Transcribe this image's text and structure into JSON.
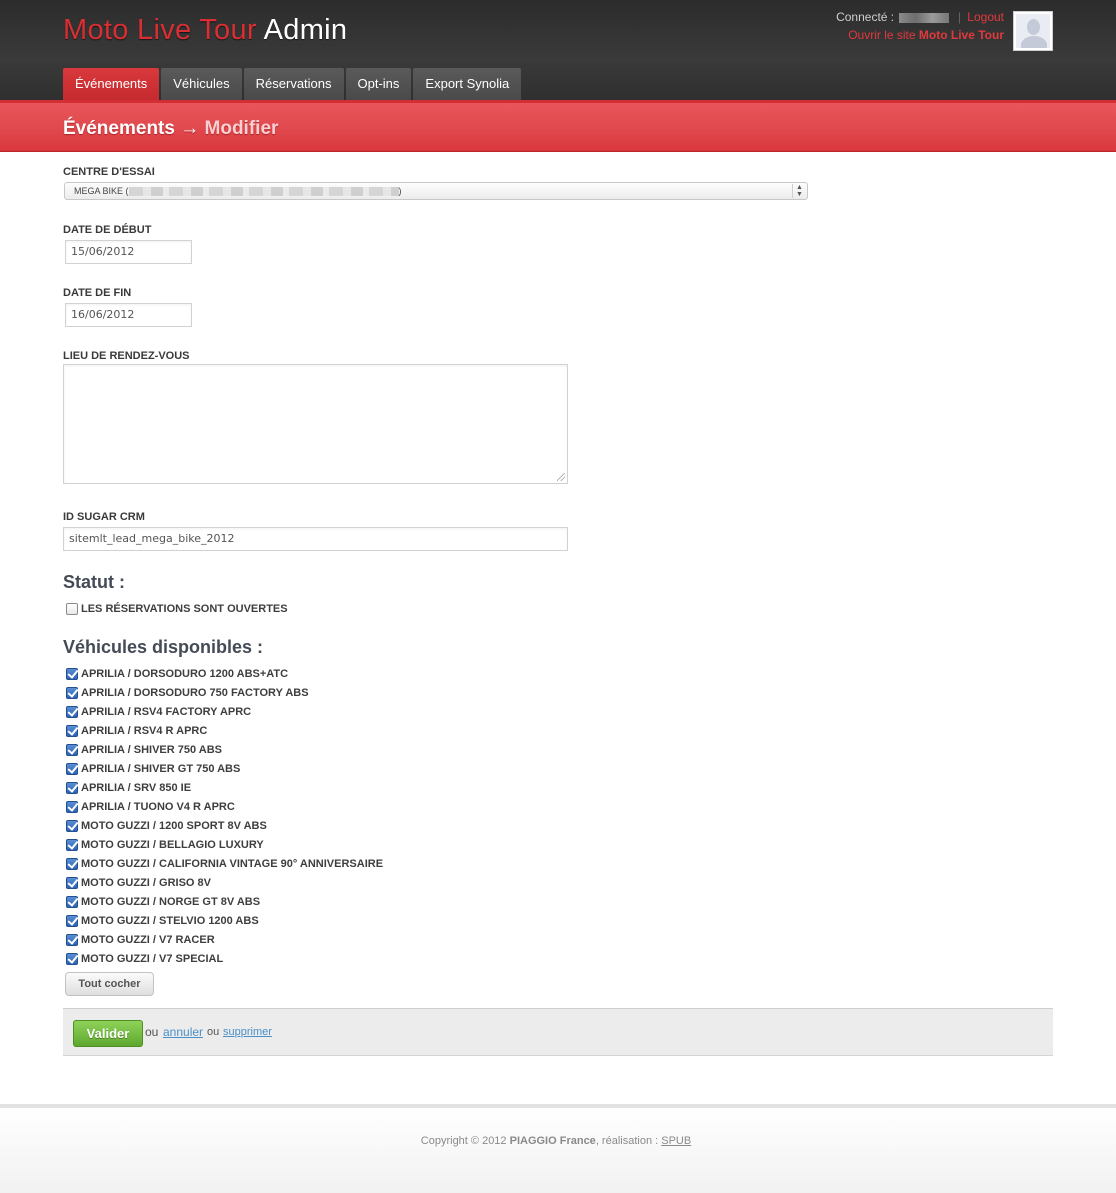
{
  "app": {
    "brand_red": "Moto Live Tour",
    "brand_white": "Admin",
    "connected_label": "Connecté :",
    "logout_label": "Logout",
    "open_site_prefix": "Ouvrir le site",
    "open_site_name": "Moto Live Tour"
  },
  "nav": {
    "tabs": [
      {
        "label": "Événements",
        "active": true
      },
      {
        "label": "Véhicules",
        "active": false
      },
      {
        "label": "Réservations",
        "active": false
      },
      {
        "label": "Opt-ins",
        "active": false
      },
      {
        "label": "Export Synolia",
        "active": false
      }
    ]
  },
  "breadcrumb": {
    "section": "Événements",
    "separator": "→",
    "page": "Modifier"
  },
  "form": {
    "centre_label": "CENTRE D'ESSAI",
    "centre_value_prefix": "MEGA BIKE (",
    "centre_value_suffix": ")",
    "date_debut_label": "DATE DE DÉBUT",
    "date_debut_value": "15/06/2012",
    "date_fin_label": "DATE DE FIN",
    "date_fin_value": "16/06/2012",
    "lieu_label": "LIEU DE RENDEZ-VOUS",
    "lieu_value": "",
    "sugar_label": "ID SUGAR CRM",
    "sugar_value": "sitemlt_lead_mega_bike_2012"
  },
  "statut": {
    "title": "Statut :",
    "reservations_label": "LES RÉSERVATIONS SONT OUVERTES",
    "reservations_checked": false
  },
  "vehicules": {
    "title": "Véhicules disponibles :",
    "items": [
      {
        "label": "APRILIA / DORSODURO 1200 ABS+ATC",
        "checked": true
      },
      {
        "label": "APRILIA / DORSODURO 750 FACTORY ABS",
        "checked": true
      },
      {
        "label": "APRILIA / RSV4 FACTORY APRC",
        "checked": true
      },
      {
        "label": "APRILIA / RSV4 R APRC",
        "checked": true
      },
      {
        "label": "APRILIA / SHIVER 750 ABS",
        "checked": true
      },
      {
        "label": "APRILIA / SHIVER GT 750 ABS",
        "checked": true
      },
      {
        "label": "APRILIA / SRV 850 IE",
        "checked": true
      },
      {
        "label": "APRILIA / TUONO V4 R APRC",
        "checked": true
      },
      {
        "label": "MOTO GUZZI / 1200 SPORT 8V ABS",
        "checked": true
      },
      {
        "label": "MOTO GUZZI / BELLAGIO LUXURY",
        "checked": true
      },
      {
        "label": "MOTO GUZZI / CALIFORNIA VINTAGE 90° ANNIVERSAIRE",
        "checked": true
      },
      {
        "label": "MOTO GUZZI / GRISO 8V",
        "checked": true
      },
      {
        "label": "MOTO GUZZI / NORGE GT 8V ABS",
        "checked": true
      },
      {
        "label": "MOTO GUZZI / STELVIO 1200 ABS",
        "checked": true
      },
      {
        "label": "MOTO GUZZI / V7 RACER",
        "checked": true
      },
      {
        "label": "MOTO GUZZI / V7 SPECIAL",
        "checked": true
      }
    ],
    "check_all_label": "Tout cocher"
  },
  "actions": {
    "submit_label": "Valider",
    "or_1": "ou",
    "cancel_label": "annuler",
    "or_2": "ou",
    "delete_label": "supprimer"
  },
  "footer": {
    "copyright": "Copyright © 2012",
    "company": "PIAGGIO France",
    "realisation": ", réalisation :",
    "agency": "SPUB"
  },
  "colors": {
    "brand_red": "#d72f33",
    "band_red": "#e14a4f",
    "valider_green": "#6fb83a",
    "link_blue": "#4a8fc7"
  }
}
